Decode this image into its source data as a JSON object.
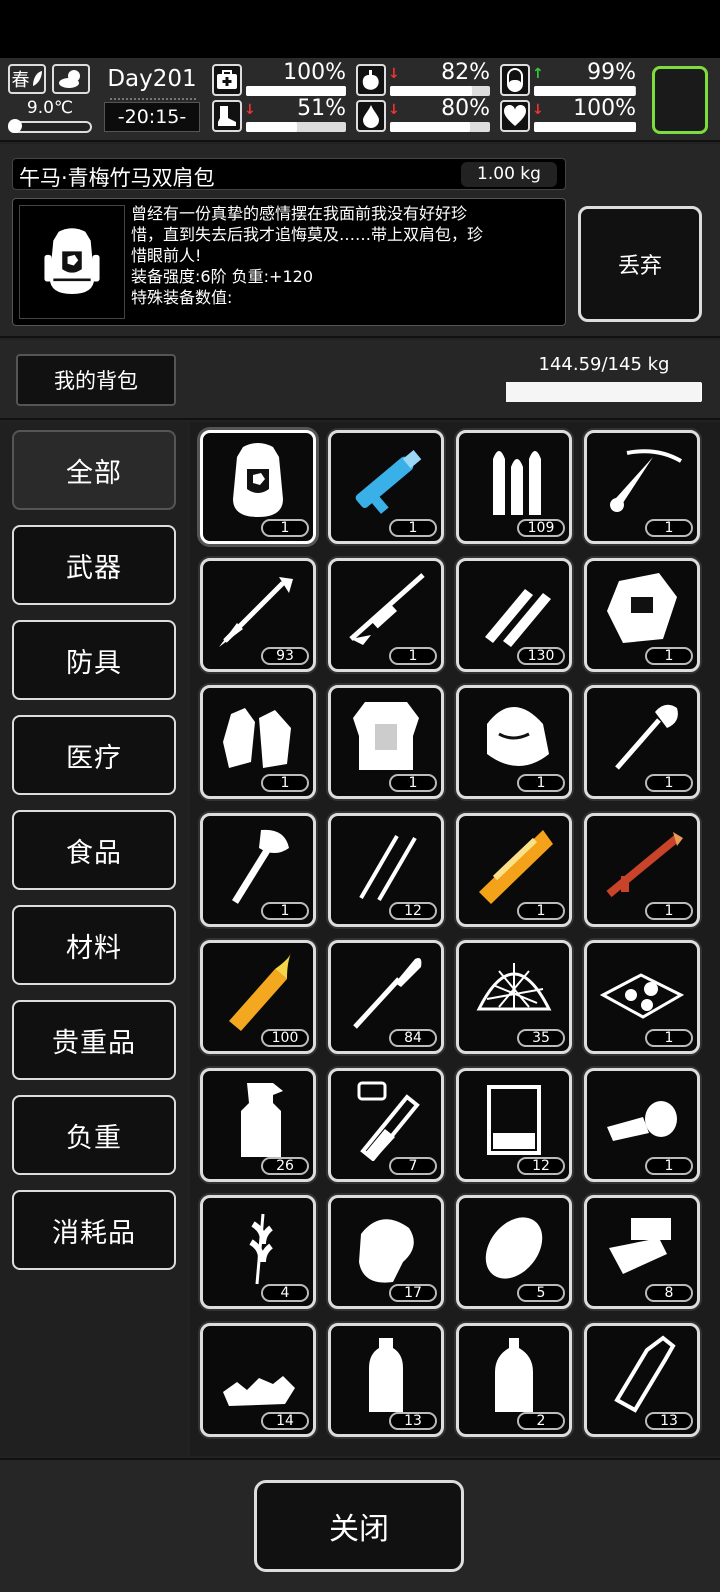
{
  "status": {
    "season": "春",
    "temperature": "9.0℃",
    "temperature_level": 0.1,
    "day": "Day201",
    "time": "-20:15-",
    "stats": [
      {
        "id": "health",
        "icon": "medkit-icon",
        "arrow": "",
        "pct": "100%",
        "level": 1.0
      },
      {
        "id": "hunger",
        "icon": "stomach-icon",
        "arrow": "↓",
        "arrow_color": "#e33",
        "pct": "82%",
        "level": 0.82
      },
      {
        "id": "energy",
        "icon": "pill-icon",
        "arrow": "↑",
        "arrow_color": "#3c3",
        "pct": "99%",
        "level": 0.99
      },
      {
        "id": "stamina",
        "icon": "boot-icon",
        "arrow": "↓",
        "arrow_color": "#e33",
        "pct": "51%",
        "level": 0.51
      },
      {
        "id": "thirst",
        "icon": "water-drop-icon",
        "arrow": "↓",
        "arrow_color": "#e33",
        "pct": "80%",
        "level": 0.8
      },
      {
        "id": "mood",
        "icon": "heart-icon",
        "arrow": "↓",
        "arrow_color": "#e33",
        "pct": "100%",
        "level": 1.0
      }
    ],
    "slot_color": "#7fdc3f"
  },
  "detail": {
    "name": "午马·青梅竹马双肩包",
    "weight": "1.00 kg",
    "icon": "backpack-icon",
    "desc_line1": "曾经有一份真挚的感情摆在我面前我没有好好珍",
    "desc_line2": "惜，直到失去后我才追悔莫及……带上双肩包，珍",
    "desc_line3": "惜眼前人!",
    "desc_line4": "装备强度:6阶  负重:+120",
    "desc_line5": "特殊装备数值:",
    "discard": "丢弃"
  },
  "bag": {
    "title": "我的背包",
    "capacity": "144.59/145 kg",
    "fill": 0.997
  },
  "categories": [
    "全部",
    "武器",
    "防具",
    "医疗",
    "食品",
    "材料",
    "贵重品",
    "负重",
    "消耗品"
  ],
  "items": [
    {
      "icon": "backpack-icon",
      "count": "1"
    },
    {
      "icon": "minigun-icon",
      "count": "1"
    },
    {
      "icon": "bullets-icon",
      "count": "109"
    },
    {
      "icon": "crossbow-icon",
      "count": "1"
    },
    {
      "icon": "arrow-icon",
      "count": "93"
    },
    {
      "icon": "sniper-rifle-icon",
      "count": "1"
    },
    {
      "icon": "rifle-rounds-icon",
      "count": "130"
    },
    {
      "icon": "helmet-icon",
      "count": "1"
    },
    {
      "icon": "gloves-icon",
      "count": "1"
    },
    {
      "icon": "body-armor-icon",
      "count": "1"
    },
    {
      "icon": "horse-mask-icon",
      "count": "1"
    },
    {
      "icon": "shovel-icon",
      "count": "1"
    },
    {
      "icon": "axe-icon",
      "count": "1"
    },
    {
      "icon": "lockpick-icon",
      "count": "12"
    },
    {
      "icon": "golden-gun-icon",
      "count": "1"
    },
    {
      "icon": "rocket-launcher-icon",
      "count": "1"
    },
    {
      "icon": "golden-shell-icon",
      "count": "100"
    },
    {
      "icon": "rocket-icon",
      "count": "84"
    },
    {
      "icon": "net-icon",
      "count": "35"
    },
    {
      "icon": "stone-tray-icon",
      "count": "1"
    },
    {
      "icon": "spray-bottle-icon",
      "count": "26"
    },
    {
      "icon": "test-tube-icon",
      "count": "7"
    },
    {
      "icon": "beaker-icon",
      "count": "12"
    },
    {
      "icon": "bandage-icon",
      "count": "1"
    },
    {
      "icon": "wheat-icon",
      "count": "4"
    },
    {
      "icon": "meat-icon",
      "count": "17"
    },
    {
      "icon": "potato-icon",
      "count": "5"
    },
    {
      "icon": "paper-icon",
      "count": "8"
    },
    {
      "icon": "rubble-icon",
      "count": "14"
    },
    {
      "icon": "water-bottle-icon",
      "count": "13"
    },
    {
      "icon": "big-bottle-icon",
      "count": "2"
    },
    {
      "icon": "glass-bottle-icon",
      "count": "13"
    }
  ],
  "close": "关闭"
}
